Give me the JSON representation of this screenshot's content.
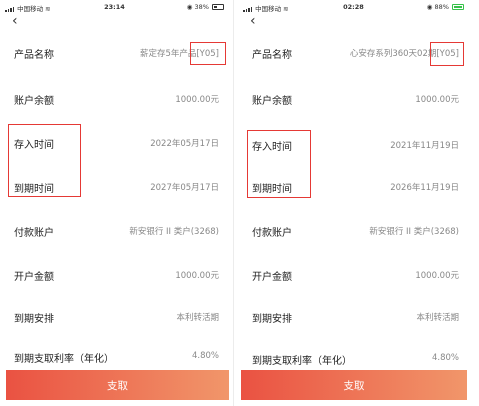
{
  "phones": [
    {
      "status": {
        "carrier": "中国移动",
        "time": "23:14",
        "battery": "38%"
      },
      "rows": [
        {
          "label": "产品名称",
          "value": "薪定存5年产品",
          "code": "[Y05]"
        },
        {
          "label": "账户余额",
          "value": "1000.00元"
        },
        {
          "label": "存入时间",
          "value": "2022年05月17日"
        },
        {
          "label": "到期时间",
          "value": "2027年05月17日"
        },
        {
          "label": "付款账户",
          "value": "新安银行 II 类户(3268)"
        },
        {
          "label": "开户金额",
          "value": "1000.00元"
        },
        {
          "label": "到期安排",
          "value": "本利转活期"
        },
        {
          "label": "到期支取利率（年化）",
          "value": "4.80%"
        }
      ],
      "button": "支取"
    },
    {
      "status": {
        "carrier": "中国移动",
        "time": "02:28",
        "battery": "88%"
      },
      "rows": [
        {
          "label": "产品名称",
          "value": "心安存系列360天02期",
          "code": "[Y05]"
        },
        {
          "label": "账户余额",
          "value": "1000.00元"
        },
        {
          "label": "存入时间",
          "value": "2021年11月19日"
        },
        {
          "label": "到期时间",
          "value": "2026年11月19日"
        },
        {
          "label": "付款账户",
          "value": "新安银行 II 类户(3268)"
        },
        {
          "label": "开户金额",
          "value": "1000.00元"
        },
        {
          "label": "到期安排",
          "value": "本利转活期"
        },
        {
          "label": "到期支取利率（年化）",
          "value": "4.80%"
        }
      ],
      "button": "支取"
    }
  ],
  "icons": {
    "back": "chevron-left-icon",
    "signal": "signal-icon",
    "wifi": "wifi-icon",
    "battery": "battery-icon"
  },
  "colors": {
    "highlight": "#e53935",
    "button_start": "#ea5242",
    "button_end": "#f1966a",
    "battery_charging": "#37c24a"
  }
}
